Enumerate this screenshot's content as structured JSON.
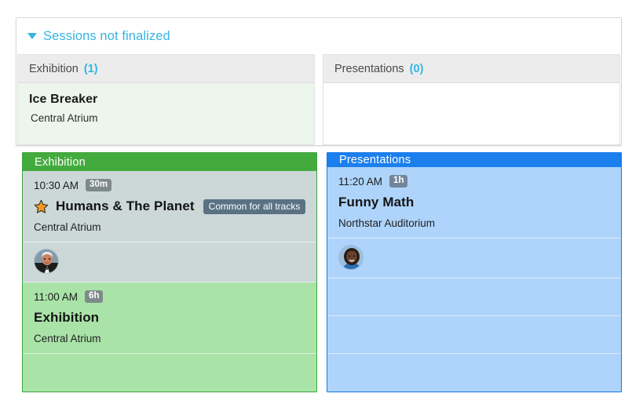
{
  "unfinalized_card": {
    "caret_icon": "caret-down-icon",
    "title": "Sessions not finalized",
    "columns": [
      {
        "label": "Exhibition",
        "count": "(1)",
        "sessions": [
          {
            "title": "Ice Breaker",
            "location": "Central Atrium"
          }
        ]
      },
      {
        "label": "Presentations",
        "count": "(0)",
        "sessions": []
      }
    ]
  },
  "tracks": [
    {
      "name": "Exhibition",
      "color": "#43ab3e",
      "body_color": "#a9e3a8",
      "sessions": [
        {
          "time": "10:30 AM",
          "duration": "30m",
          "starred": true,
          "star_icon": "star-icon",
          "title": "Humans & The Planet",
          "badge": "Common for all tracks",
          "location": "Central Atrium",
          "selected": true,
          "speakers": [
            {
              "avatar_icon": "avatar-photo-male"
            }
          ]
        },
        {
          "time": "11:00 AM",
          "duration": "6h",
          "starred": false,
          "title": "Exhibition",
          "badge": "",
          "location": "Central Atrium",
          "selected": false,
          "speakers": []
        }
      ]
    },
    {
      "name": "Presentations",
      "color": "#1b7fed",
      "body_color": "#aed4fb",
      "sessions": [
        {
          "time": "11:20 AM",
          "duration": "1h",
          "starred": false,
          "title": "Funny Math",
          "badge": "",
          "location": "Northstar Auditorium",
          "selected": false,
          "speakers": [
            {
              "avatar_icon": "avatar-photo-female"
            }
          ]
        }
      ]
    }
  ],
  "colors": {
    "link_blue": "#35b4e3",
    "track_green": "#43ab3e",
    "track_blue": "#1b7fed",
    "selected_grey": "#ccd8d8",
    "badge_slate": "#5b7284",
    "duration_grey": "#7e8a8a",
    "star_orange": "#f5991e"
  }
}
